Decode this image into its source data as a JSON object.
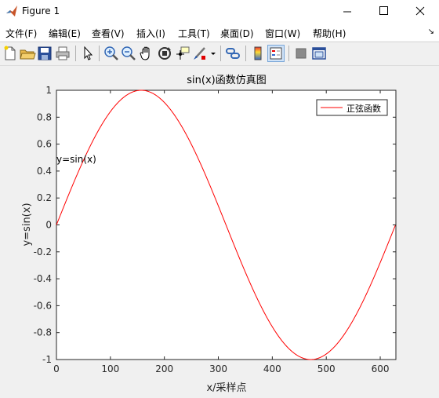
{
  "window": {
    "title": "Figure 1"
  },
  "menu": [
    "文件(F)",
    "编辑(E)",
    "查看(V)",
    "插入(I)",
    "工具(T)",
    "桌面(D)",
    "窗口(W)",
    "帮助(H)"
  ],
  "toolbar": {
    "icons": [
      "new-file-icon",
      "open-folder-icon",
      "save-icon",
      "print-icon",
      "pointer-icon",
      "zoom-in-icon",
      "zoom-out-icon",
      "pan-hand-icon",
      "rotate-3d-icon",
      "data-cursor-icon",
      "brush-icon",
      "link-plot-icon",
      "colorbar-icon",
      "legend-icon",
      "hide-tools-icon",
      "dock-icon"
    ]
  },
  "chart_data": {
    "type": "line",
    "title": "sin(x)函数仿真图",
    "xlabel": "x/采样点",
    "ylabel": "y=sin(x)",
    "xlim": [
      0,
      629
    ],
    "ylim": [
      -1,
      1
    ],
    "xticks": [
      "0",
      "100",
      "200",
      "300",
      "400",
      "500",
      "600"
    ],
    "yticks": [
      "1",
      "0.8",
      "0.6",
      "0.4",
      "0.2",
      "0",
      "-0.2",
      "-0.4",
      "-0.6",
      "-0.8",
      "-1"
    ],
    "annotation": "y=sin(x)",
    "legend": {
      "position": "top-right",
      "entries": [
        "正弦函数"
      ]
    },
    "grid": false,
    "series": [
      {
        "name": "正弦函数",
        "color": "#ff0000",
        "function": "sin(x/100)",
        "x_start": 0,
        "x_end": 628
      }
    ]
  }
}
